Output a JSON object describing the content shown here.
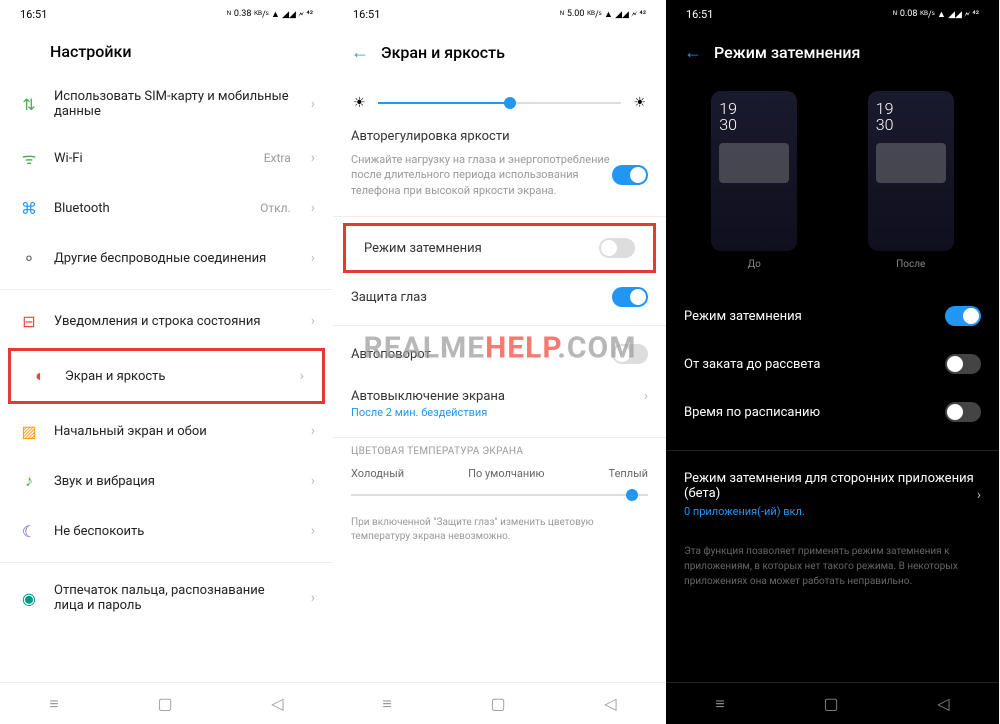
{
  "status": {
    "time": "16:51",
    "net1": "0.38",
    "net2": "5.00",
    "net3": "0.08",
    "unit": "KB/S",
    "bat": "42"
  },
  "s1": {
    "title": "Настройки",
    "items": [
      {
        "icon": "⇅",
        "label": "Использовать SIM-карту и мобильные данные",
        "cls": "ic-sim"
      },
      {
        "icon": "ᯤ",
        "label": "Wi-Fi",
        "extra": "Extra",
        "cls": "ic-wifi"
      },
      {
        "icon": "⌘",
        "label": "Bluetooth",
        "extra": "Откл.",
        "cls": "ic-bt"
      },
      {
        "icon": "⚬",
        "label": "Другие беспроводные соединения",
        "cls": "ic-wire"
      },
      {
        "icon": "⊟",
        "label": "Уведомления и строка состояния",
        "cls": "ic-notif"
      },
      {
        "icon": "◐",
        "label": "Экран и яркость",
        "cls": "ic-screen",
        "highlight": true
      },
      {
        "icon": "▨",
        "label": "Начальный экран и обои",
        "cls": "ic-home"
      },
      {
        "icon": "♪",
        "label": "Звук и вибрация",
        "cls": "ic-sound"
      },
      {
        "icon": "☾",
        "label": "Не беспокоить",
        "cls": "ic-dnd"
      },
      {
        "icon": "◉",
        "label": "Отпечаток пальца, распознавание лица и пароль",
        "cls": "ic-finger"
      }
    ]
  },
  "s2": {
    "title": "Экран и яркость",
    "autobrightness": {
      "title": "Авторегулировка яркости",
      "desc": "Снижайте нагрузку на глаза и энергопотребление после длительного периода использования телефона при высокой яркости экрана."
    },
    "darkmode": {
      "label": "Режим затемнения"
    },
    "eyecare": {
      "label": "Защита глаз"
    },
    "autorotate": {
      "label": "Автоповорот"
    },
    "autooff": {
      "label": "Автовыключение экрана",
      "sub": "После 2 мин. бездействия"
    },
    "temp": {
      "caption": "ЦВЕТОВАЯ ТЕМПЕРАТУРА ЭКРАНА",
      "cold": "Холодный",
      "default": "По умолчанию",
      "warm": "Теплый"
    },
    "note": "При включенной \"Защите глаз\" изменить цветовую температуру экрана невозможно."
  },
  "s3": {
    "title": "Режим затемнения",
    "before": "До",
    "after": "После",
    "ptime1": "19",
    "ptime2": "30",
    "darkmode": "Режим затемнения",
    "sunset": "От заката до рассвета",
    "schedule": "Время по расписанию",
    "thirdparty": {
      "label": "Режим затемнения для сторонних приложения (бета)",
      "sub": "0 приложения(-ий) вкл."
    },
    "note": "Эта функция позволяет применять режим затемнения к приложениям, в которых нет такого режима. В некоторых приложениях она может работать неправильно."
  },
  "watermark": {
    "p1": "REALME",
    "p2": "HELP",
    "p3": ".COM"
  }
}
